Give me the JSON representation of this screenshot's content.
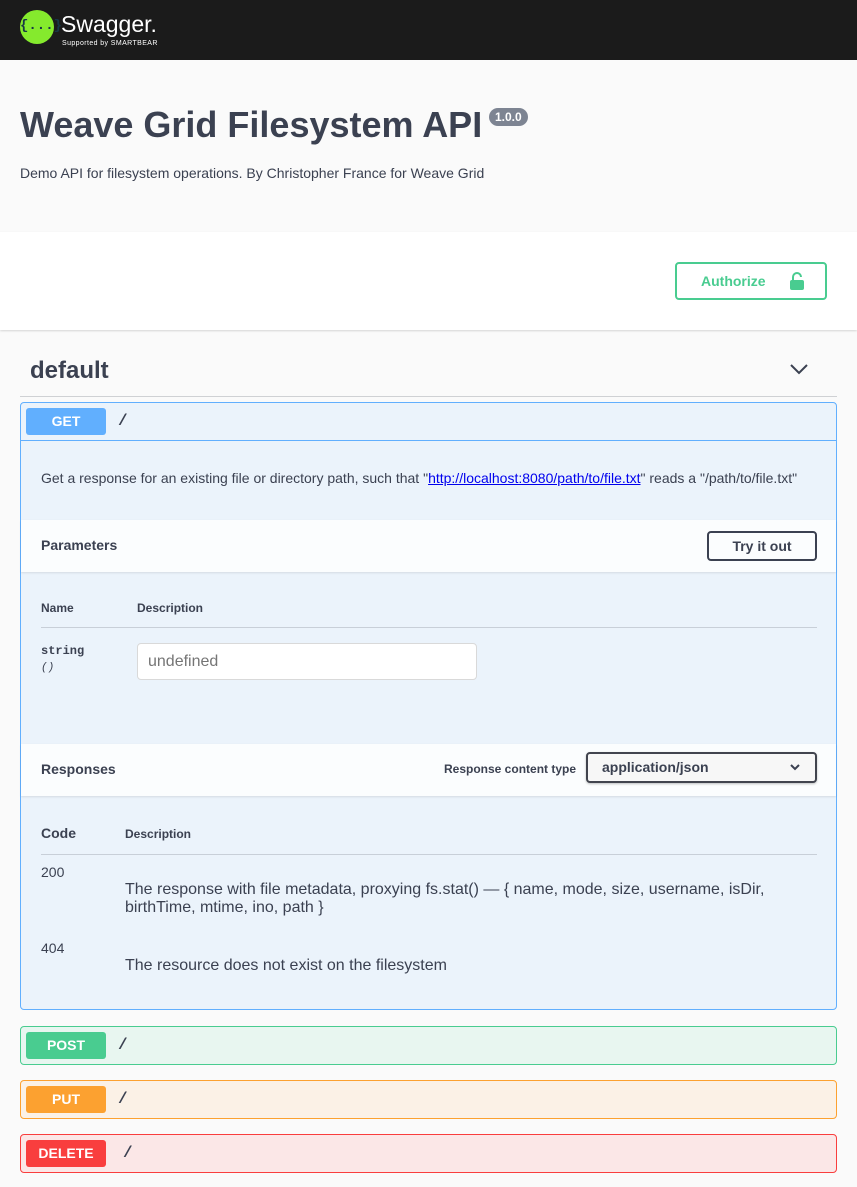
{
  "topbar": {
    "logo_glyph": "{...}",
    "brand": "Swagger.",
    "tagline": "Supported by SMARTBEAR"
  },
  "info": {
    "title": "Weave Grid Filesystem API",
    "version": "1.0.0",
    "description": "Demo API for filesystem operations. By Christopher France for Weave Grid"
  },
  "authorize": {
    "label": "Authorize",
    "icon": "lock-icon"
  },
  "tag": {
    "name": "default",
    "icon": "chevron-down-icon"
  },
  "get_op": {
    "method": "GET",
    "path": "/",
    "description_pre": "Get a response for an existing file or directory path, such that \"",
    "description_link": "http://localhost:8080/path/to/file.txt",
    "description_post": "\" reads a \"/path/to/file.txt\"",
    "parameters": {
      "title": "Parameters",
      "try_label": "Try it out",
      "col_name": "Name",
      "col_desc": "Description",
      "param_type": "string",
      "param_in": "()",
      "input_placeholder": "undefined"
    },
    "responses": {
      "title": "Responses",
      "content_type_label": "Response content type",
      "content_type_value": "application/json",
      "col_code": "Code",
      "col_desc": "Description",
      "rows": [
        {
          "code": "200",
          "description": "The response with file metadata, proxying fs.stat() — { name, mode, size, username, isDir, birthTime, mtime, ino, path }"
        },
        {
          "code": "404",
          "description": "The resource does not exist on the filesystem"
        }
      ]
    }
  },
  "other_ops": [
    {
      "method": "POST",
      "path": "/",
      "color": "#49cc90"
    },
    {
      "method": "PUT",
      "path": "/",
      "color": "#fca130"
    },
    {
      "method": "DELETE",
      "path": "/",
      "color": "#f93e3e"
    }
  ],
  "colors": {
    "get": "#61affe",
    "post": "#49cc90",
    "put": "#fca130",
    "delete": "#f93e3e"
  }
}
